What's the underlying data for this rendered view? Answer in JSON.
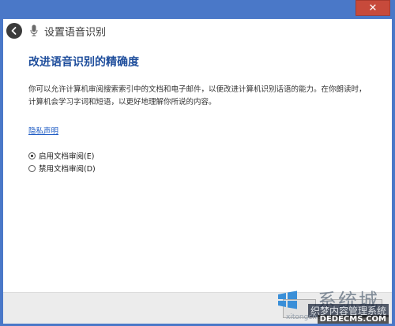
{
  "window": {
    "close_glyph": "✕"
  },
  "header": {
    "title": "设置语音识别"
  },
  "main": {
    "title": "改进语音识别的精确度",
    "description": "你可以允许计算机审阅搜索索引中的文档和电子邮件，以便改进计算机识别话语的能力。在你朗读时，计算机会学习字词和短语，以更好地理解你所说的内容。",
    "privacy_link": "隐私声明",
    "options": [
      {
        "label": "启用文档审阅(E)",
        "selected": true
      },
      {
        "label": "禁用文档审阅(D)",
        "selected": false
      }
    ]
  },
  "watermark": {
    "main": "系统城",
    "sub": "织梦内容管理系统",
    "domain": "DEDECMS.COM",
    "url": "xitongcheng.com"
  },
  "colors": {
    "frame": "#4a78c8",
    "title": "#1f4e9c",
    "link": "#1f5cc4",
    "close": "#c74a3b"
  }
}
